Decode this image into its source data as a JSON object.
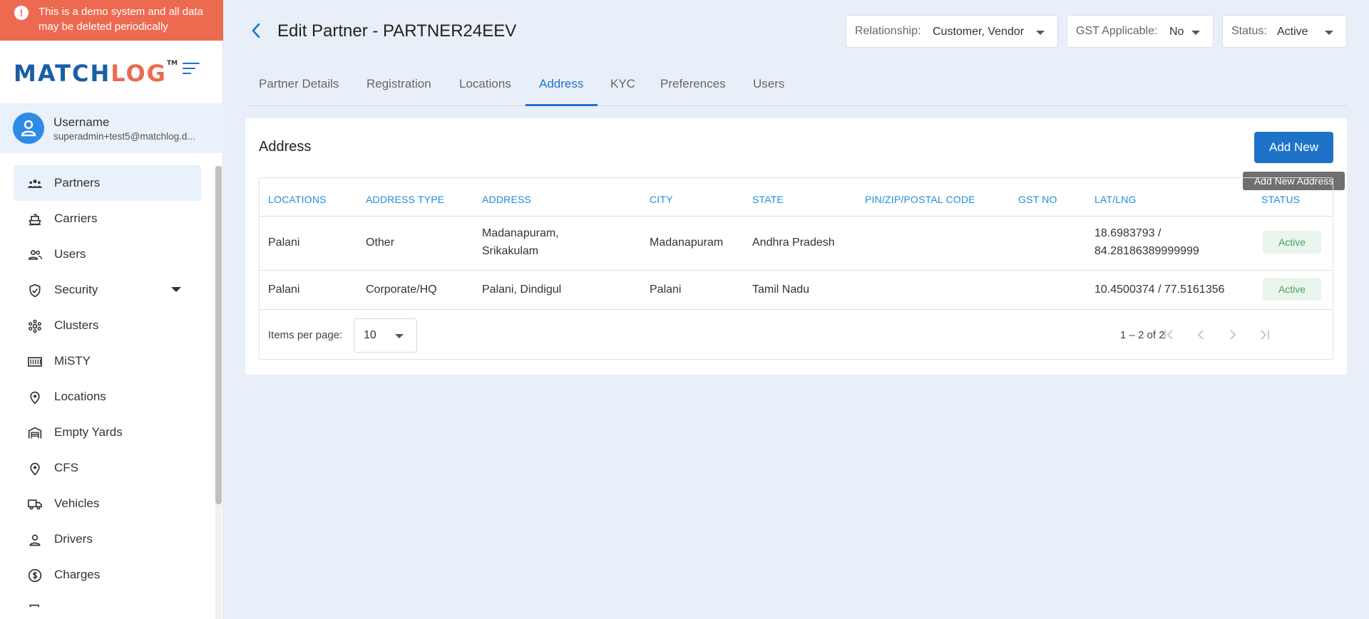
{
  "banner": {
    "text": "This is a demo system and all data may be deleted periodically",
    "icon": "alert-circle-icon"
  },
  "logo": {
    "match": "MATCH",
    "log": "LOG",
    "tm": "TM"
  },
  "user": {
    "name": "Username",
    "email": "superadmin+test5@matchlog.d..."
  },
  "sidebar": {
    "items": [
      {
        "label": "Partners",
        "icon": "partners-icon",
        "active": true
      },
      {
        "label": "Carriers",
        "icon": "ship-icon"
      },
      {
        "label": "Users",
        "icon": "users-icon"
      },
      {
        "label": "Security",
        "icon": "shield-icon",
        "expandable": true
      },
      {
        "label": "Clusters",
        "icon": "cluster-icon"
      },
      {
        "label": "MiSTY",
        "icon": "container-icon"
      },
      {
        "label": "Locations",
        "icon": "location-pin-icon"
      },
      {
        "label": "Empty Yards",
        "icon": "warehouse-icon"
      },
      {
        "label": "CFS",
        "icon": "location-pin-icon"
      },
      {
        "label": "Vehicles",
        "icon": "truck-icon"
      },
      {
        "label": "Drivers",
        "icon": "person-icon"
      },
      {
        "label": "Charges",
        "icon": "dollar-circle-icon"
      }
    ]
  },
  "header": {
    "title": "Edit Partner - PARTNER24EEV",
    "relationship": {
      "label": "Relationship:",
      "value": "Customer, Vendor"
    },
    "gst": {
      "label": "GST Applicable:",
      "value": "No"
    },
    "status": {
      "label": "Status:",
      "value": "Active"
    }
  },
  "tabs": [
    "Partner Details",
    "Registration",
    "Locations",
    "Address",
    "KYC",
    "Preferences",
    "Users"
  ],
  "active_tab": "Address",
  "card": {
    "title": "Address",
    "add_button": "Add New",
    "tooltip": "Add New Address"
  },
  "table": {
    "columns": [
      "LOCATIONS",
      "ADDRESS TYPE",
      "ADDRESS",
      "CITY",
      "STATE",
      "PIN/ZIP/POSTAL CODE",
      "GST NO",
      "LAT/LNG",
      "STATUS"
    ],
    "rows": [
      {
        "location": "Palani",
        "address_type": "Other",
        "address_1": "Madanapuram,",
        "address_2": "Srikakulam",
        "city": "Madanapuram",
        "state": "Andhra Pradesh",
        "pin": "",
        "gst": "",
        "latlng_1": "18.6983793 /",
        "latlng_2": "84.28186389999999",
        "status": "Active"
      },
      {
        "location": "Palani",
        "address_type": "Corporate/HQ",
        "address_1": "Palani, Dindigul",
        "address_2": "",
        "city": "Palani",
        "state": "Tamil Nadu",
        "pin": "",
        "gst": "",
        "latlng_1": "10.4500374 / 77.5161356",
        "latlng_2": "",
        "status": "Active"
      }
    ]
  },
  "paginator": {
    "items_per_page_label": "Items per page:",
    "items_per_page": "10",
    "range": "1 – 2 of 2"
  },
  "colors": {
    "accent": "#1e73c8",
    "banner": "#ec6a50",
    "status_active_bg": "#e9f5ec",
    "status_active_text": "#46a35c"
  }
}
